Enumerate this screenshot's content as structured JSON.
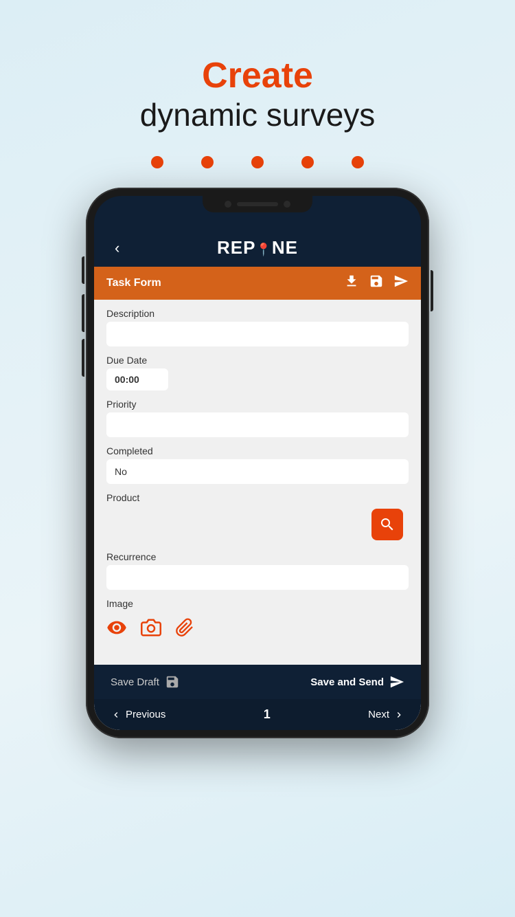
{
  "hero": {
    "create_label": "Create",
    "subtitle": "dynamic surveys"
  },
  "dots": [
    1,
    2,
    3,
    4,
    5
  ],
  "header": {
    "back_icon": "‹",
    "logo_text_rep": "REP",
    "logo_text_zone": "NE",
    "logo_pin": "📍"
  },
  "toolbar": {
    "title": "Task Form",
    "download_icon": "⬇",
    "save_icon": "💾",
    "send_icon": "➤"
  },
  "form": {
    "description_label": "Description",
    "description_value": "",
    "due_date_label": "Due Date",
    "due_date_value": "00:00",
    "priority_label": "Priority",
    "priority_value": "",
    "completed_label": "Completed",
    "completed_value": "No",
    "product_label": "Product",
    "recurrence_label": "Recurrence",
    "recurrence_value": "",
    "image_label": "Image"
  },
  "bottom_bar": {
    "save_draft_label": "Save Draft",
    "save_send_label": "Save and Send"
  },
  "pagination": {
    "prev_label": "Previous",
    "page_num": "1",
    "next_label": "Next"
  }
}
